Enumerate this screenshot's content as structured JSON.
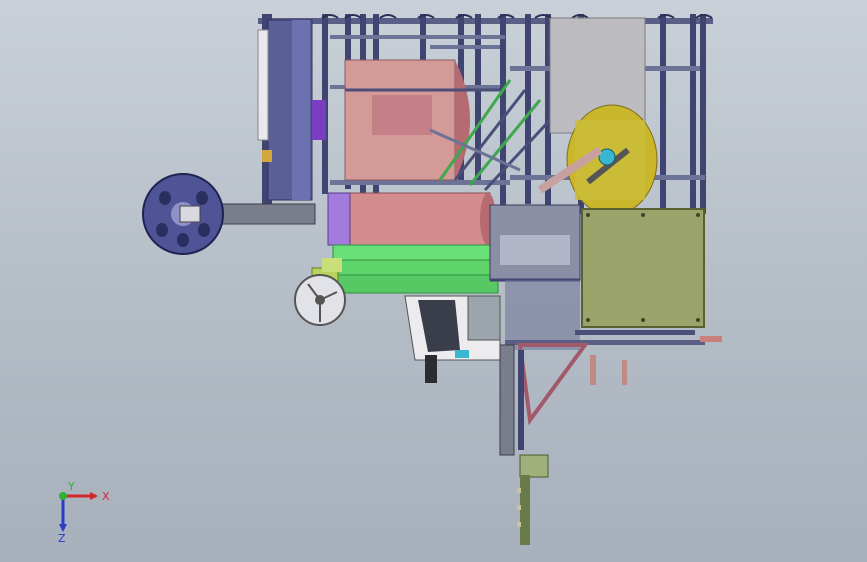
{
  "scene": {
    "model": "machine-assembly-top-view",
    "colors": {
      "frame": "#4a4f7a",
      "frame_light": "#6b7396",
      "roller_pink": "#d98c8c",
      "roller_pink_dark": "#b66a72",
      "green": "#5fd46a",
      "green_dark": "#3ea84c",
      "olive_panel": "#9aa36a",
      "olive_dark": "#6f7a45",
      "gold": "#c9b62a",
      "purple": "#8a6fc7",
      "reel": "#4e5496",
      "gray_box": "#a9a9ae",
      "white_plate": "#e9e9ec",
      "teal": "#4d8f9a"
    }
  },
  "triad": {
    "x_label": "X",
    "y_label": "Y",
    "z_label": "Z",
    "x_color": "#d4262b",
    "y_color": "#2fb135",
    "z_color": "#2a3cc8"
  }
}
